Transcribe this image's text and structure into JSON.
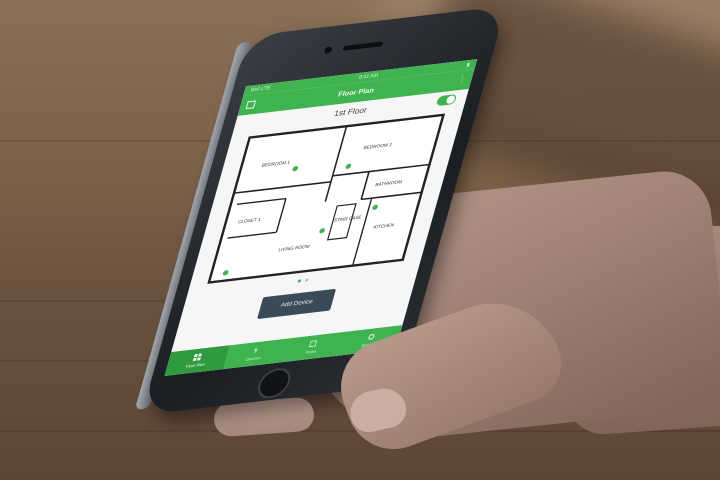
{
  "status": {
    "carrier": "Bell LTE",
    "time": "9:41 AM"
  },
  "header": {
    "title": "Floor Plan"
  },
  "floor": {
    "label": "1st Floor",
    "toggle_on": true
  },
  "rooms": [
    "BEDROOM 1",
    "BEDROOM 2",
    "BATHROOM",
    "CLOSET 1",
    "STAIR CASE",
    "KITCHEN",
    "LIVING ROOM"
  ],
  "pager": {
    "count": 2,
    "active": 0
  },
  "actions": {
    "add_device": "Add Device"
  },
  "tabs": [
    {
      "label": "Floor Plan",
      "icon": "grid-icon"
    },
    {
      "label": "Devices",
      "icon": "plug-icon"
    },
    {
      "label": "Rules",
      "icon": "rules-icon"
    },
    {
      "label": "Settings",
      "icon": "gear-icon"
    }
  ],
  "colors": {
    "accent": "#3fb34f",
    "button": "#3a4a57"
  }
}
